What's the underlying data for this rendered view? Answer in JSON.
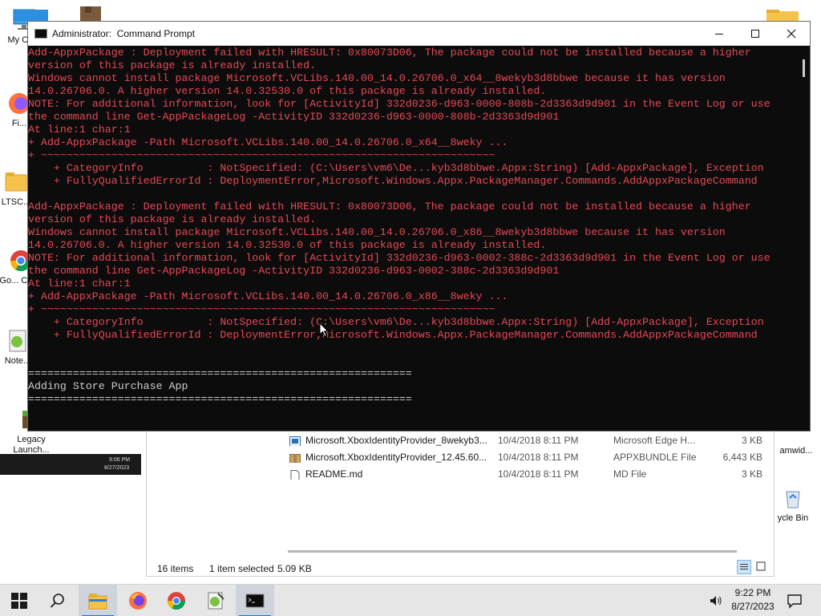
{
  "desktop": {
    "icons": [
      {
        "label": "My Co..."
      },
      {
        "label": "Fi..."
      },
      {
        "label": "LTSC..."
      },
      {
        "label": "Go... Chr..."
      },
      {
        "label": "Note..."
      },
      {
        "label": "Legacy Launch..."
      },
      {
        "label": "amwid..."
      },
      {
        "label": "ycle Bin"
      }
    ]
  },
  "thumbnail": {
    "time": "9:06 PM",
    "date": "8/27/2023"
  },
  "explorer": {
    "files": [
      {
        "name": "Microsoft.XboxIdentityProvider_8wekyb3...",
        "date": "10/4/2018 8:11 PM",
        "type": "Microsoft Edge H...",
        "size": "3 KB",
        "icon": "edge-html-file-icon"
      },
      {
        "name": "Microsoft.XboxIdentityProvider_12.45.60...",
        "date": "10/4/2018 8:11 PM",
        "type": "APPXBUNDLE File",
        "size": "6,443 KB",
        "icon": "package-file-icon"
      },
      {
        "name": "README.md",
        "date": "10/4/2018 8:11 PM",
        "type": "MD File",
        "size": "3 KB",
        "icon": "text-file-icon"
      }
    ],
    "status": {
      "items": "16 items",
      "selected": "1 item selected",
      "size": "5.09 KB"
    }
  },
  "cmd": {
    "title": "Administrator:  Command Prompt",
    "lines": [
      {
        "text": "Add-AppxPackage : Deployment failed with HRESULT: 0x80073D06, The package could not be installed because a higher",
        "color": "red"
      },
      {
        "text": "version of this package is already installed.",
        "color": "red"
      },
      {
        "text": "Windows cannot install package Microsoft.VCLibs.140.00_14.0.26706.0_x64__8wekyb3d8bbwe because it has version",
        "color": "red"
      },
      {
        "text": "14.0.26706.0. A higher version 14.0.32530.0 of this package is already installed.",
        "color": "red"
      },
      {
        "text": "NOTE: For additional information, look for [ActivityId] 332d0236-d963-0000-808b-2d3363d9d901 in the Event Log or use",
        "color": "red"
      },
      {
        "text": "the command line Get-AppPackageLog -ActivityID 332d0236-d963-0000-808b-2d3363d9d901",
        "color": "red"
      },
      {
        "text": "At line:1 char:1",
        "color": "red"
      },
      {
        "text": "+ Add-AppxPackage -Path Microsoft.VCLibs.140.00_14.0.26706.0_x64__8weky ...",
        "color": "red"
      },
      {
        "text": "+ ~~~~~~~~~~~~~~~~~~~~~~~~~~~~~~~~~~~~~~~~~~~~~~~~~~~~~~~~~~~~~~~~~~~~~~~",
        "color": "red"
      },
      {
        "text": "    + CategoryInfo          : NotSpecified: (C:\\Users\\vm6\\De...kyb3d8bbwe.Appx:String) [Add-AppxPackage], Exception",
        "color": "red"
      },
      {
        "text": "    + FullyQualifiedErrorId : DeploymentError,Microsoft.Windows.Appx.PackageManager.Commands.AddAppxPackageCommand",
        "color": "red"
      },
      {
        "text": "",
        "color": "red"
      },
      {
        "text": "Add-AppxPackage : Deployment failed with HRESULT: 0x80073D06, The package could not be installed because a higher",
        "color": "red"
      },
      {
        "text": "version of this package is already installed.",
        "color": "red"
      },
      {
        "text": "Windows cannot install package Microsoft.VCLibs.140.00_14.0.26706.0_x86__8wekyb3d8bbwe because it has version",
        "color": "red"
      },
      {
        "text": "14.0.26706.0. A higher version 14.0.32530.0 of this package is already installed.",
        "color": "red"
      },
      {
        "text": "NOTE: For additional information, look for [ActivityId] 332d0236-d963-0002-388c-2d3363d9d901 in the Event Log or use",
        "color": "red"
      },
      {
        "text": "the command line Get-AppPackageLog -ActivityID 332d0236-d963-0002-388c-2d3363d9d901",
        "color": "red"
      },
      {
        "text": "At line:1 char:1",
        "color": "red"
      },
      {
        "text": "+ Add-AppxPackage -Path Microsoft.VCLibs.140.00_14.0.26706.0_x86__8weky ...",
        "color": "red"
      },
      {
        "text": "+ ~~~~~~~~~~~~~~~~~~~~~~~~~~~~~~~~~~~~~~~~~~~~~~~~~~~~~~~~~~~~~~~~~~~~~~~",
        "color": "red"
      },
      {
        "text": "    + CategoryInfo          : NotSpecified: (C:\\Users\\vm6\\De...kyb3d8bbwe.Appx:String) [Add-AppxPackage], Exception",
        "color": "red"
      },
      {
        "text": "    + FullyQualifiedErrorId : DeploymentError,Microsoft.Windows.Appx.PackageManager.Commands.AddAppxPackageCommand",
        "color": "red"
      },
      {
        "text": "",
        "color": "red"
      },
      {
        "text": "",
        "color": "red"
      },
      {
        "text": "============================================================",
        "color": "white"
      },
      {
        "text": "Adding Store Purchase App",
        "color": "white"
      },
      {
        "text": "============================================================",
        "color": "white"
      }
    ]
  },
  "taskbar": {
    "apps": [
      {
        "icon": "search-icon"
      },
      {
        "icon": "file-explorer-icon"
      },
      {
        "icon": "firefox-icon"
      },
      {
        "icon": "chrome-icon"
      },
      {
        "icon": "notepad-plus-plus-icon"
      },
      {
        "icon": "command-prompt-icon"
      }
    ],
    "time": "9:22 PM",
    "date": "8/27/2023"
  },
  "colors": {
    "console_bg": "#0c0c0c",
    "console_red": "#e74856",
    "console_white": "#cccccc",
    "taskbar_bg": "#e6e6e6",
    "accent": "#1a73e8"
  }
}
